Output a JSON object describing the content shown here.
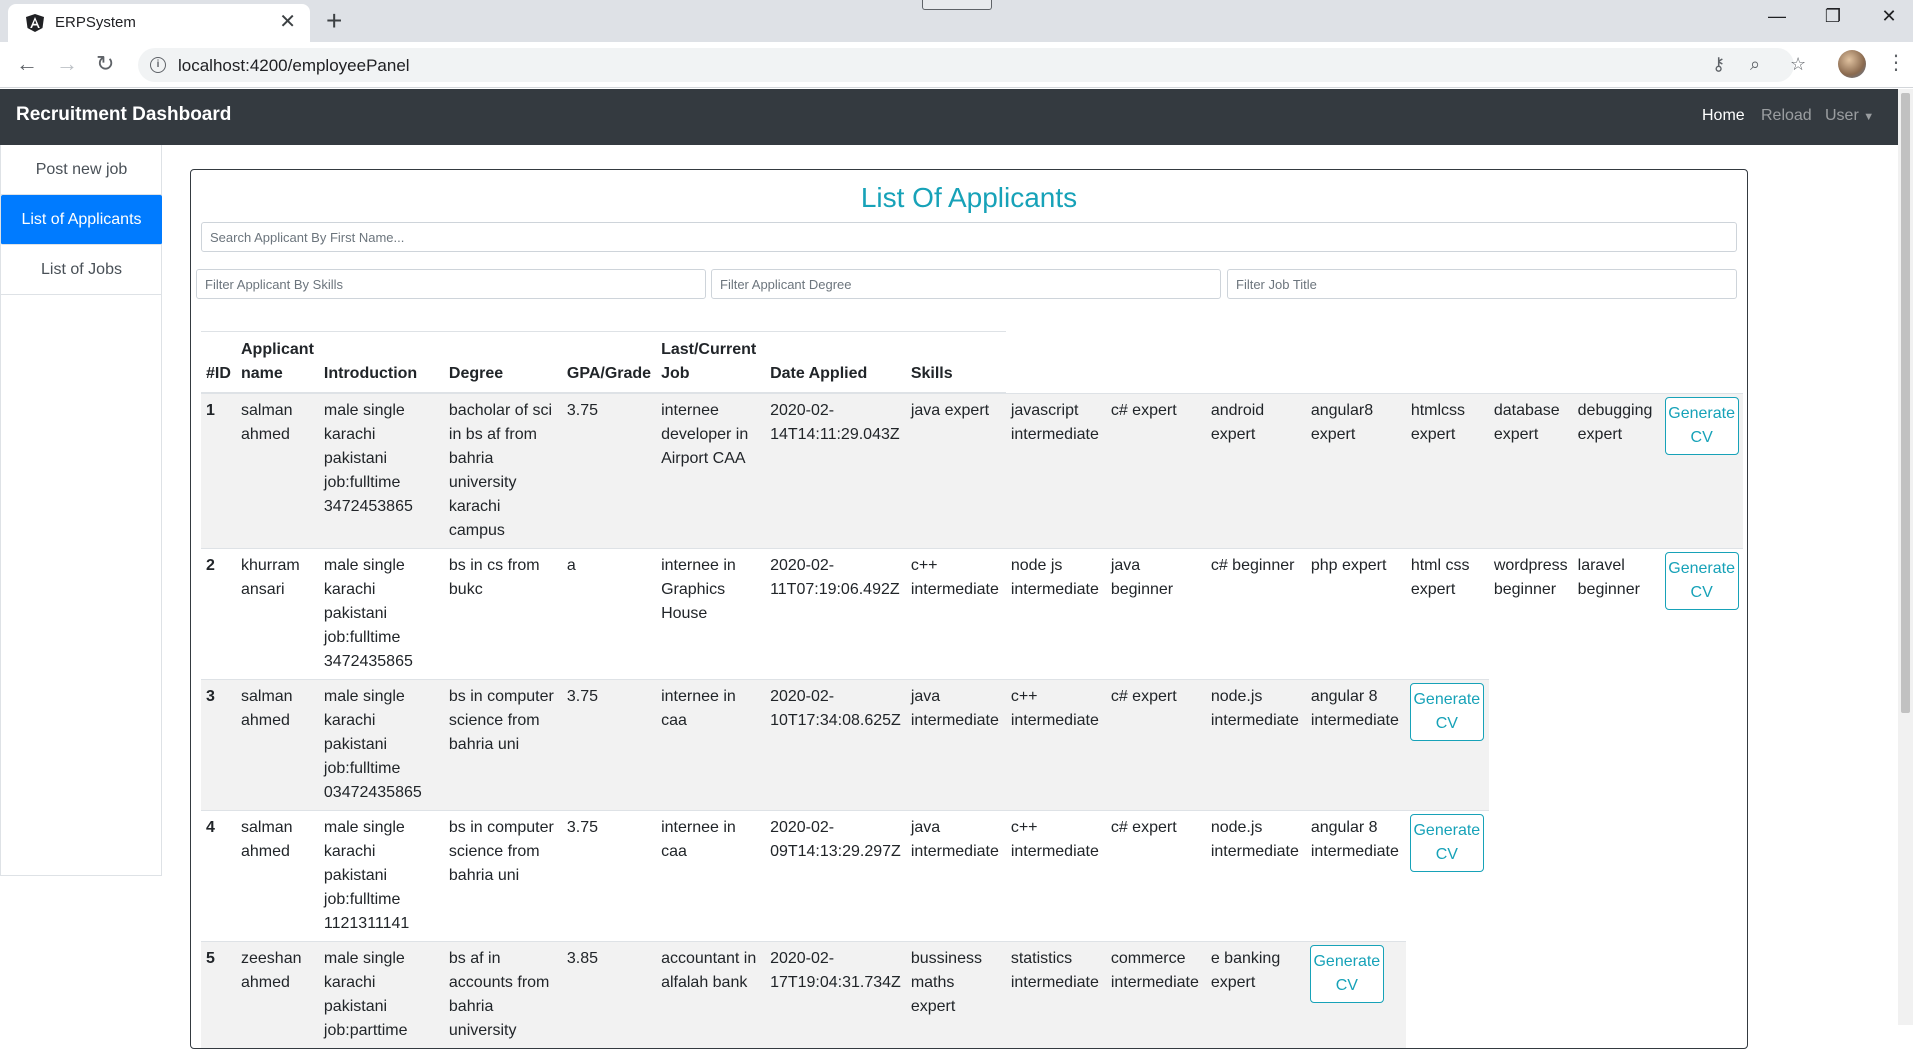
{
  "browser": {
    "tab_title": "ERPSystem",
    "url": "localhost:4200/employeePanel"
  },
  "app": {
    "brand": "Recruitment Dashboard",
    "nav": {
      "home": "Home",
      "reload": "Reload",
      "user": "User"
    }
  },
  "sidebar": {
    "items": [
      {
        "label": "Post new job",
        "active": false
      },
      {
        "label": "List of Applicants",
        "active": true
      },
      {
        "label": "List of Jobs",
        "active": false
      }
    ]
  },
  "main": {
    "title": "List Of Applicants",
    "search_placeholder": "Search Applicant By First Name...",
    "filter_skills_placeholder": "Filter Applicant By Skills",
    "filter_degree_placeholder": "Filter Applicant Degree",
    "filter_job_placeholder": "Filter Job Title",
    "columns": [
      "#ID",
      "Applicant name",
      "Introduction",
      "Degree",
      "GPA/Grade",
      "Last/Current Job",
      "Date Applied",
      "Skills"
    ],
    "button_label": "Generate CV",
    "rows": [
      {
        "id": "1",
        "name": "salman ahmed",
        "intro": "male single karachi pakistani job:fulltime 3472453865",
        "degree": "bacholar of sci in bs af from bahria university karachi campus",
        "gpa": "3.75",
        "job": "internee developer in Airport CAA",
        "date": "2020-02-14T14:11:29.043Z",
        "skills": [
          "java expert",
          "javascript intermediate",
          "c# expert",
          "android expert",
          "angular8 expert",
          "htmlcss expert",
          "database expert",
          "debugging expert"
        ]
      },
      {
        "id": "2",
        "name": "khurram ansari",
        "intro": "male single karachi pakistani job:fulltime 3472435865",
        "degree": "bs in cs from bukc",
        "gpa": "a",
        "job": "internee in Graphics House",
        "date": "2020-02-11T07:19:06.492Z",
        "skills": [
          "c++ intermediate",
          "node js intermediate",
          "java beginner",
          "c# beginner",
          "php expert",
          "html css expert",
          "wordpress beginner",
          "laravel beginner"
        ]
      },
      {
        "id": "3",
        "name": "salman ahmed",
        "intro": "male single karachi pakistani job:fulltime 03472435865",
        "degree": "bs in computer science from bahria uni",
        "gpa": "3.75",
        "job": "internee in caa",
        "date": "2020-02-10T17:34:08.625Z",
        "skills": [
          "java intermediate",
          "c++ intermediate",
          "c# expert",
          "node.js intermediate",
          "angular 8 intermediate"
        ]
      },
      {
        "id": "4",
        "name": "salman ahmed",
        "intro": "male single karachi pakistani job:fulltime 1121311141",
        "degree": "bs in computer science from bahria uni",
        "gpa": "3.75",
        "job": "internee in caa",
        "date": "2020-02-09T14:13:29.297Z",
        "skills": [
          "java intermediate",
          "c++ intermediate",
          "c# expert",
          "node.js intermediate",
          "angular 8 intermediate"
        ]
      },
      {
        "id": "5",
        "name": "zeeshan ahmed",
        "intro": "male single karachi pakistani job:parttime",
        "degree": "bs af in accounts from bahria university",
        "gpa": "3.85",
        "job": "accountant in alfalah bank",
        "date": "2020-02-17T19:04:31.734Z",
        "skills": [
          "bussiness maths expert",
          "statistics intermediate",
          "commerce intermediate",
          "e banking expert"
        ]
      }
    ]
  }
}
